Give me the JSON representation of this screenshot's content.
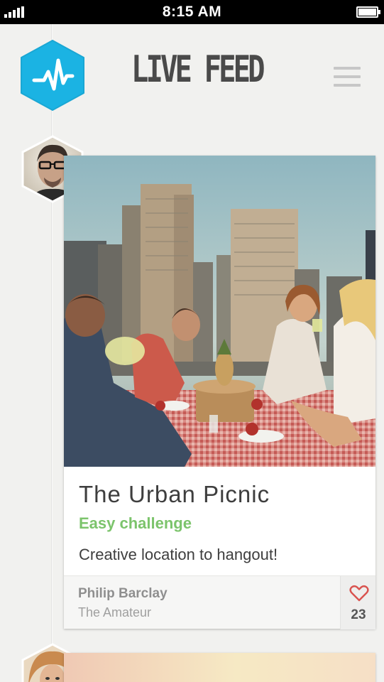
{
  "status_bar": {
    "time": "8:15 AM",
    "signal_icon": "signal-bars-icon",
    "battery_icon": "battery-icon"
  },
  "header": {
    "title": "LIVE FEED",
    "logo_icon": "pulse-hexagon-icon",
    "menu_icon": "hamburger-menu-icon"
  },
  "colors": {
    "accent": "#1bb3e3",
    "challenge_green": "#7cc46c",
    "heart": "#d9534f"
  },
  "feed": [
    {
      "title": "The Urban Picnic",
      "difficulty": "Easy challenge",
      "description": "Creative location to hangout!",
      "author": "Philip Barclay",
      "rank": "The Amateur",
      "likes": "23",
      "like_icon": "heart-icon"
    }
  ]
}
